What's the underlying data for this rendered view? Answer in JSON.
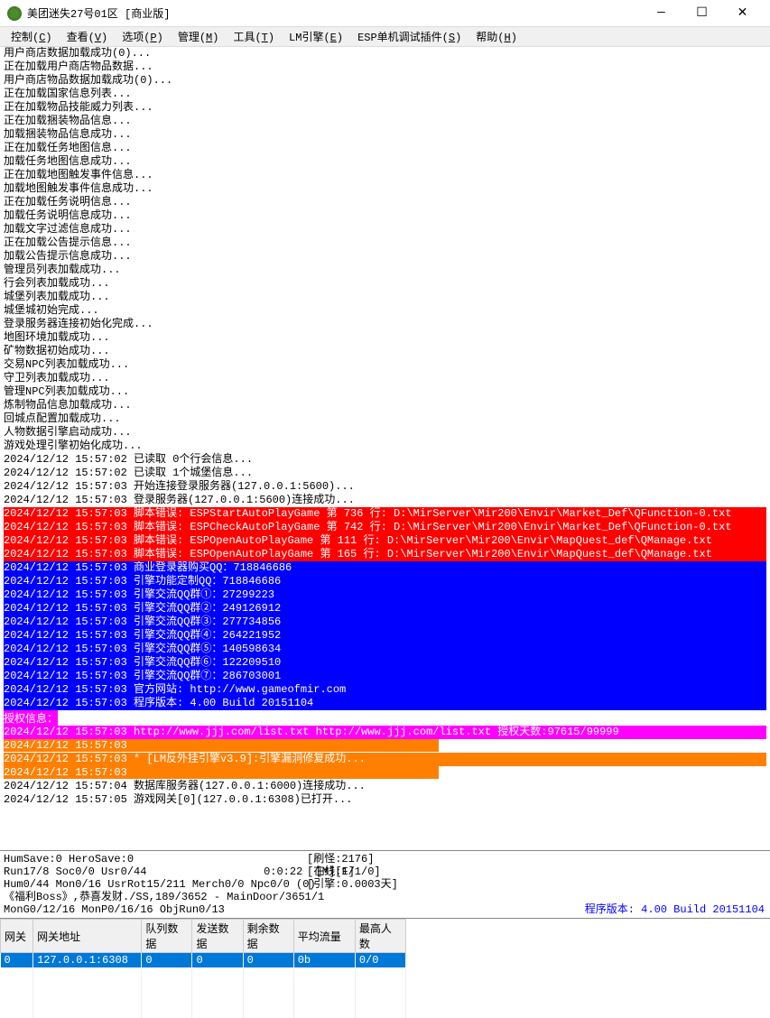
{
  "title": "美团迷失27号01区 [商业版]",
  "menu": [
    "控制(C)",
    "查看(V)",
    "选项(P)",
    "管理(M)",
    "工具(T)",
    "LM引擎(E)",
    "ESP单机调试插件(S)",
    "帮助(H)"
  ],
  "logs": [
    {
      "t": "",
      "c": "用户商店数据加载成功(0)..."
    },
    {
      "t": "",
      "c": "正在加载用户商店物品数据..."
    },
    {
      "t": "",
      "c": "用户商店物品数据加载成功(0)..."
    },
    {
      "t": "",
      "c": "正在加载国家信息列表..."
    },
    {
      "t": "",
      "c": "正在加载物品技能威力列表..."
    },
    {
      "t": "",
      "c": "正在加载捆装物品信息..."
    },
    {
      "t": "",
      "c": "加载捆装物品信息成功..."
    },
    {
      "t": "",
      "c": "正在加载任务地图信息..."
    },
    {
      "t": "",
      "c": "加载任务地图信息成功..."
    },
    {
      "t": "",
      "c": "正在加载地图触发事件信息..."
    },
    {
      "t": "",
      "c": "加载地图触发事件信息成功..."
    },
    {
      "t": "",
      "c": "正在加载任务说明信息..."
    },
    {
      "t": "",
      "c": "加载任务说明信息成功..."
    },
    {
      "t": "",
      "c": "加载文字过滤信息成功..."
    },
    {
      "t": "",
      "c": "正在加载公告提示信息..."
    },
    {
      "t": "",
      "c": "加载公告提示信息成功..."
    },
    {
      "t": "",
      "c": "管理员列表加载成功..."
    },
    {
      "t": "",
      "c": "行会列表加载成功..."
    },
    {
      "t": "",
      "c": "城堡列表加载成功..."
    },
    {
      "t": "",
      "c": "城堡城初始完成..."
    },
    {
      "t": "",
      "c": "登录服务器连接初始化完成..."
    },
    {
      "t": "",
      "c": "地图环境加载成功..."
    },
    {
      "t": "",
      "c": "矿物数据初始成功..."
    },
    {
      "t": "",
      "c": "交易NPC列表加载成功..."
    },
    {
      "t": "",
      "c": "守卫列表加载成功..."
    },
    {
      "t": "",
      "c": "管理NPC列表加载成功..."
    },
    {
      "t": "",
      "c": "炼制物品信息加载成功..."
    },
    {
      "t": "",
      "c": "回城点配置加载成功..."
    },
    {
      "t": "",
      "c": "人物数据引擎启动成功..."
    },
    {
      "t": "",
      "c": "游戏处理引擎初始化成功..."
    },
    {
      "t": "",
      "c": "2024/12/12 15:57:02 已读取 0个行会信息..."
    },
    {
      "t": "",
      "c": "2024/12/12 15:57:02 已读取 1个城堡信息..."
    },
    {
      "t": "",
      "c": "2024/12/12 15:57:03 开始连接登录服务器(127.0.0.1:5600)..."
    },
    {
      "t": "",
      "c": "2024/12/12 15:57:03 登录服务器(127.0.0.1:5600)连接成功..."
    },
    {
      "t": "red",
      "c": "2024/12/12 15:57:03 脚本错误: ESPStartAutoPlayGame 第 736 行: D:\\MirServer\\Mir200\\Envir\\Market_Def\\QFunction-0.txt"
    },
    {
      "t": "red",
      "c": "2024/12/12 15:57:03 脚本错误: ESPCheckAutoPlayGame 第 742 行: D:\\MirServer\\Mir200\\Envir\\Market_Def\\QFunction-0.txt"
    },
    {
      "t": "red",
      "c": "2024/12/12 15:57:03 脚本错误: ESPOpenAutoPlayGame 第 111 行: D:\\MirServer\\Mir200\\Envir\\MapQuest_def\\QManage.txt"
    },
    {
      "t": "red",
      "c": "2024/12/12 15:57:03 脚本错误: ESPOpenAutoPlayGame 第 165 行: D:\\MirServer\\Mir200\\Envir\\MapQuest_def\\QManage.txt"
    },
    {
      "t": "blue",
      "c": "2024/12/12 15:57:03 商业登录器购买QQ：718846686"
    },
    {
      "t": "blue",
      "c": "2024/12/12 15:57:03 引擎功能定制QQ：718846686"
    },
    {
      "t": "blue",
      "c": "2024/12/12 15:57:03 引擎交流QQ群①：27299223"
    },
    {
      "t": "blue",
      "c": "2024/12/12 15:57:03 引擎交流QQ群②：249126912"
    },
    {
      "t": "blue",
      "c": "2024/12/12 15:57:03 引擎交流QQ群③：277734856"
    },
    {
      "t": "blue",
      "c": "2024/12/12 15:57:03 引擎交流QQ群④：264221952"
    },
    {
      "t": "blue",
      "c": "2024/12/12 15:57:03 引擎交流QQ群⑤：140598634"
    },
    {
      "t": "blue",
      "c": "2024/12/12 15:57:03 引擎交流QQ群⑥：122209510"
    },
    {
      "t": "blue",
      "c": "2024/12/12 15:57:03 引擎交流QQ群⑦：286703001"
    },
    {
      "t": "blue",
      "c": "2024/12/12 15:57:03 官方网站: http://www.gameofmir.com"
    },
    {
      "t": "blue",
      "c": "2024/12/12 15:57:03 程序版本: 4.00 Build 20151104"
    },
    {
      "t": "magenta-label",
      "c": "授权信息："
    },
    {
      "t": "magenta",
      "c": "2024/12/12 15:57:03 http://www.jjj.com/list.txt http://www.jjj.com/list.txt 授权天数:97615/99999"
    },
    {
      "t": "orange",
      "c": "2024/12/12 15:57:03 "
    },
    {
      "t": "orange",
      "c": "2024/12/12 15:57:03 * [LM反外挂引擎v3.9]:引擎漏洞修复成功..."
    },
    {
      "t": "orange",
      "c": "2024/12/12 15:57:03 "
    },
    {
      "t": "",
      "c": "2024/12/12 15:57:04 数据库服务器(127.0.0.1:6000)连接成功..."
    },
    {
      "t": "",
      "c": "2024/12/12 15:57:05 游戏网关[0](127.0.0.1:6308)已打开..."
    }
  ],
  "status": {
    "line1": "HumSave:0 HeroSave:0",
    "line2_left": "Run17/8 Soc0/0 Usr0/44",
    "line2_mid": "0:0:22",
    "line2_right": "[M][F]",
    "line3": "Hum0/44 Mon0/16 UsrRot15/211 Merch0/0 Npc0/0 (0)",
    "line4": "《福利Boss》,恭喜发财./SS,189/3652 - MainDoor/3651/1",
    "line5": "MonG0/12/16 MonP0/16/16 ObjRun0/13",
    "mid1": "[刷怪:2176]",
    "mid2": "[在线:1/1/0]",
    "mid3": "[引擎:0.0003天]",
    "version": "程序版本: 4.00 Build 20151104"
  },
  "table": {
    "headers": [
      "网关",
      "网关地址",
      "队列数据",
      "发送数据",
      "剩余数据",
      "平均流量",
      "最高人数"
    ],
    "row": [
      "0",
      "127.0.0.1:6308",
      "0",
      "0",
      "0",
      "0b",
      "0/0"
    ]
  }
}
